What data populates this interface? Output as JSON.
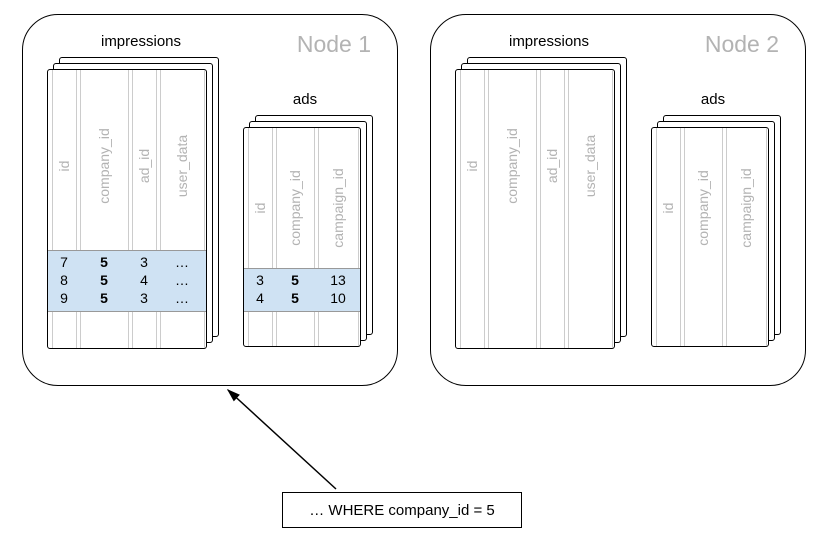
{
  "nodes": {
    "node1": {
      "label": "Node 1"
    },
    "node2": {
      "label": "Node 2"
    }
  },
  "tables": {
    "impressions": {
      "title": "impressions",
      "columns": [
        "id",
        "company_id",
        "ad_id",
        "user_data"
      ]
    },
    "ads": {
      "title": "ads",
      "columns": [
        "id",
        "company_id",
        "campaign_id"
      ]
    }
  },
  "data": {
    "node1_impressions": [
      {
        "id": "7",
        "company_id": "5",
        "ad_id": "3",
        "user_data": "…"
      },
      {
        "id": "8",
        "company_id": "5",
        "ad_id": "4",
        "user_data": "…"
      },
      {
        "id": "9",
        "company_id": "5",
        "ad_id": "3",
        "user_data": "…"
      }
    ],
    "node1_ads": [
      {
        "id": "3",
        "company_id": "5",
        "campaign_id": "13"
      },
      {
        "id": "4",
        "company_id": "5",
        "campaign_id": "10"
      }
    ]
  },
  "query": {
    "text": "… WHERE company_id = 5"
  }
}
